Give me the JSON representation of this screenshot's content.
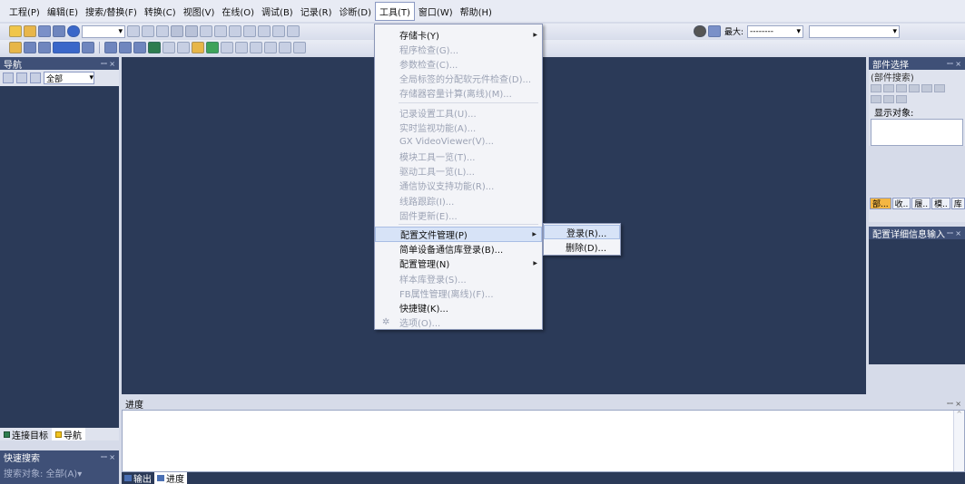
{
  "menubar": {
    "items": [
      "工程(P)",
      "编辑(E)",
      "搜索/替换(F)",
      "转换(C)",
      "视图(V)",
      "在线(O)",
      "调试(B)",
      "记录(R)",
      "诊断(D)",
      "工具(T)",
      "窗口(W)",
      "帮助(H)"
    ]
  },
  "toolbar": {
    "zoom_label": "最大:",
    "zoom_value": "--------"
  },
  "nav": {
    "title": "导航",
    "filter": "全部",
    "tabs": [
      "连接目标",
      "导航"
    ]
  },
  "quick_search": {
    "title": "快速搜索",
    "target": "搜索对象: 全部(A)▾"
  },
  "progress": {
    "title": "进度",
    "tabs": [
      "输出",
      "进度"
    ]
  },
  "parts": {
    "title": "部件选择",
    "search": "(部件搜索)",
    "display_label": "显示对象:",
    "tabs": [
      "部...",
      "收..",
      "履..",
      "模..",
      "库"
    ]
  },
  "detail": {
    "title": "配置详细信息输入"
  },
  "tools_menu": {
    "items": [
      {
        "label": "存储卡(Y)",
        "enabled": true,
        "submenu": true
      },
      {
        "label": "程序检查(G)...",
        "enabled": false
      },
      {
        "label": "参数检查(C)...",
        "enabled": false
      },
      {
        "label": "全局标签的分配软元件检查(D)...",
        "enabled": false
      },
      {
        "label": "存储器容量计算(离线)(M)...",
        "enabled": false
      },
      {
        "label": "记录设置工具(U)...",
        "enabled": false
      },
      {
        "label": "实时监视功能(A)...",
        "enabled": false
      },
      {
        "label": "GX VideoViewer(V)...",
        "enabled": false
      },
      {
        "label": "模块工具一览(T)...",
        "enabled": false
      },
      {
        "label": "驱动工具一览(L)...",
        "enabled": false
      },
      {
        "label": "通信协议支持功能(R)...",
        "enabled": false
      },
      {
        "label": "线路跟踪(I)...",
        "enabled": false
      },
      {
        "label": "固件更新(E)...",
        "enabled": false
      },
      {
        "label": "配置文件管理(P)",
        "enabled": true,
        "submenu": true,
        "highlighted": true
      },
      {
        "label": "简单设备通信库登录(B)...",
        "enabled": true
      },
      {
        "label": "配置管理(N)",
        "enabled": true,
        "submenu": true
      },
      {
        "label": "样本库登录(S)...",
        "enabled": false
      },
      {
        "label": "FB属性管理(离线)(F)...",
        "enabled": false
      },
      {
        "label": "快捷键(K)...",
        "enabled": true
      },
      {
        "label": "选项(O)...",
        "enabled": false
      }
    ]
  },
  "sub_menu": {
    "items": [
      "登录(R)...",
      "删除(D)..."
    ]
  },
  "colors": {
    "dark_pane": "#2b3a58",
    "panel_title": "#3f5077",
    "chrome": "#d6dbe9",
    "highlight": "#d7e3f7"
  }
}
